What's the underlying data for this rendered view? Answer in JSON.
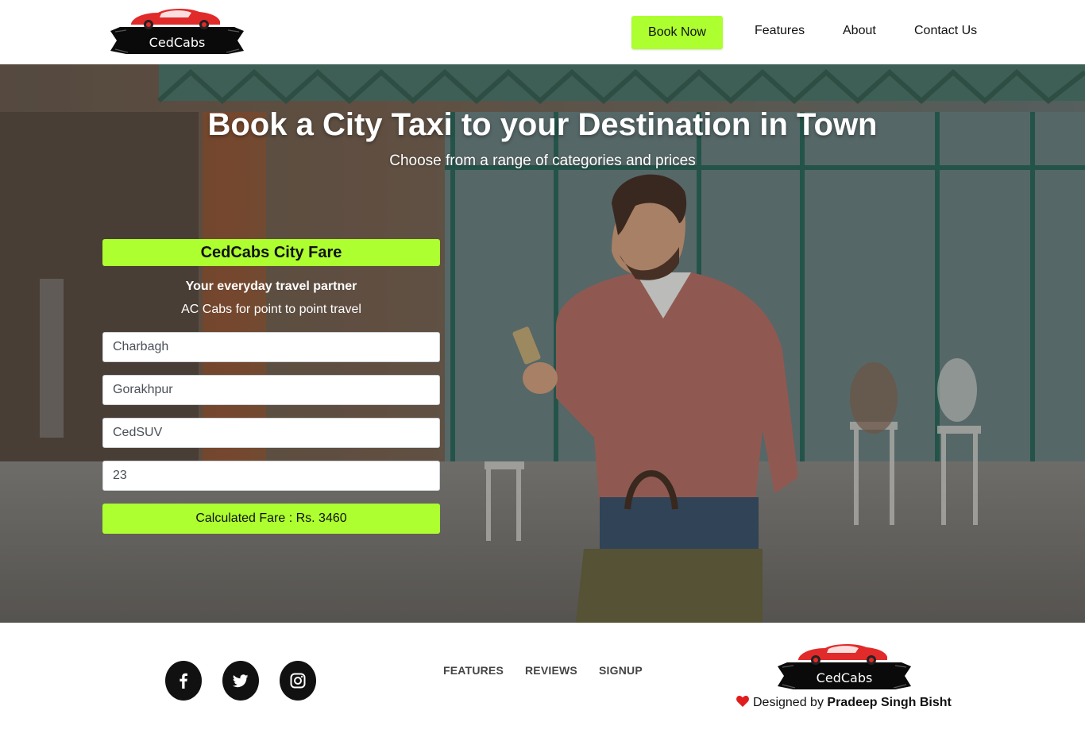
{
  "brand": {
    "name": "CedCabs",
    "accent_color": "#adff2f"
  },
  "nav": {
    "book_now": "Book Now",
    "features": "Features",
    "about": "About",
    "contact": "Contact Us"
  },
  "hero": {
    "title": "Book a City Taxi to your Destination in Town",
    "subtitle": "Choose from a range of categories and prices"
  },
  "card": {
    "heading": "CedCabs City Fare",
    "tagline": "Your everyday travel partner",
    "description": "AC Cabs for point to point travel",
    "pickup": "Charbagh",
    "drop": "Gorakhpur",
    "cab_type": "CedSUV",
    "luggage": "23",
    "fare_label": "Calculated Fare : Rs. 3460"
  },
  "footer": {
    "links": {
      "features": "FEATURES",
      "reviews": "REVIEWS",
      "signup": "SIGNUP"
    },
    "credit_prefix": "Designed by",
    "credit_name": "Pradeep Singh Bisht",
    "social": [
      "facebook-icon",
      "twitter-icon",
      "instagram-icon"
    ]
  }
}
